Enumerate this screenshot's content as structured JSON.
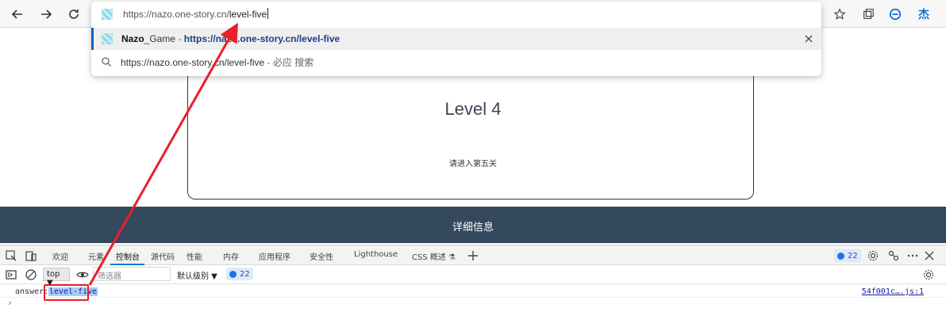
{
  "browser": {
    "address": {
      "base": "https://nazo.one-story.cn/",
      "path": "level-five"
    },
    "suggestions": [
      {
        "title_bold": "Nazo",
        "title_rest": "_Game",
        "separator": " - ",
        "url": "https://nazo.one-story.cn/level-five"
      },
      {
        "query": "https://nazo.one-story.cn/level-five",
        "suffix": " - 必应 搜索"
      }
    ],
    "profile_initial": "杰"
  },
  "page": {
    "level_title": "Level 4",
    "hint": "请进入第五关",
    "footer": "详细信息"
  },
  "devtools": {
    "tabs": [
      "欢迎",
      "元素",
      "控制台",
      "源代码",
      "性能",
      "内存",
      "应用程序",
      "安全性",
      "Lighthouse",
      "CSS 概述 ⚗"
    ],
    "issues_count": "22",
    "context": "top",
    "filter_placeholder": "筛选器",
    "level": "默认级别",
    "message_count": "22",
    "console": {
      "key": "answer:",
      "value": "level-five",
      "source": "54f001c….js:1",
      "prompt": "›"
    }
  },
  "colors": {
    "annotation": "#e8202a",
    "footer_bg": "#34495e",
    "accent": "#1a73e8"
  }
}
